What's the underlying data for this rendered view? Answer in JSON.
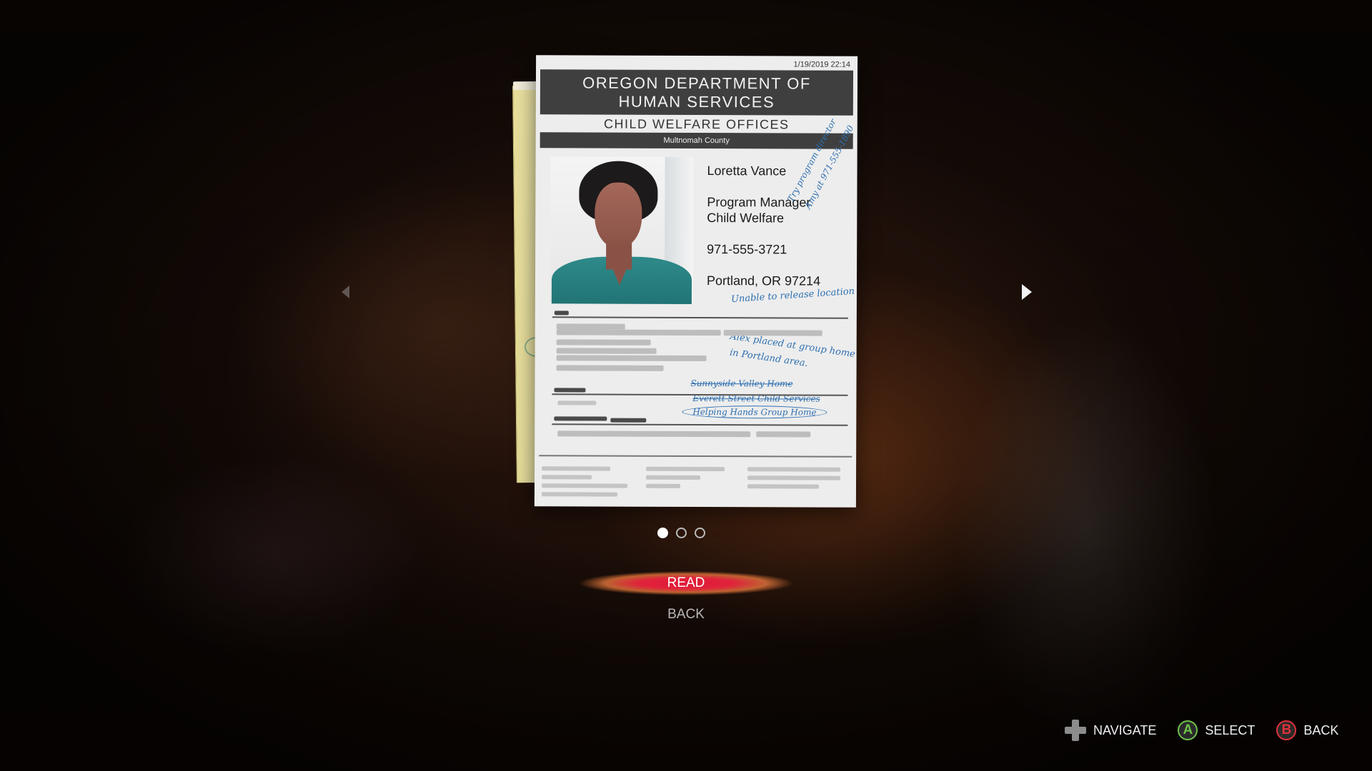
{
  "document": {
    "timestamp": "1/19/2019 22:14",
    "header_line1": "OREGON DEPARTMENT OF",
    "header_line2": "HUMAN SERVICES",
    "office": "CHILD WELFARE OFFICES",
    "county": "Multnomah County",
    "contact": {
      "name": "Loretta Vance",
      "title_line1": "Program Manager",
      "title_line2": "Child Welfare",
      "phone": "971-555-3721",
      "city": "Portland, OR 97214"
    },
    "notes": {
      "side_note_line1": "Try program director",
      "side_note_line2": "Amy at 971-555-1890",
      "location_note": "Unable to release location",
      "placement_line1": "Alex placed at group home",
      "placement_line2": "in Portland area.",
      "crossed_1": "Sunnyside Valley Home",
      "crossed_2": "Everett Street Child Services",
      "circled": "Helping Hands Group Home"
    }
  },
  "pager": {
    "total": 3,
    "active_index": 0
  },
  "menu": {
    "read_label": "READ",
    "back_label": "BACK"
  },
  "prompts": {
    "navigate_label": "NAVIGATE",
    "select_label": "SELECT",
    "select_button": "A",
    "back_label": "BACK",
    "back_button": "B"
  },
  "colors": {
    "accent_red": "#e0183a",
    "button_a": "#6fc24a",
    "button_b": "#e0323c",
    "ink_blue": "#2d6fb0"
  }
}
